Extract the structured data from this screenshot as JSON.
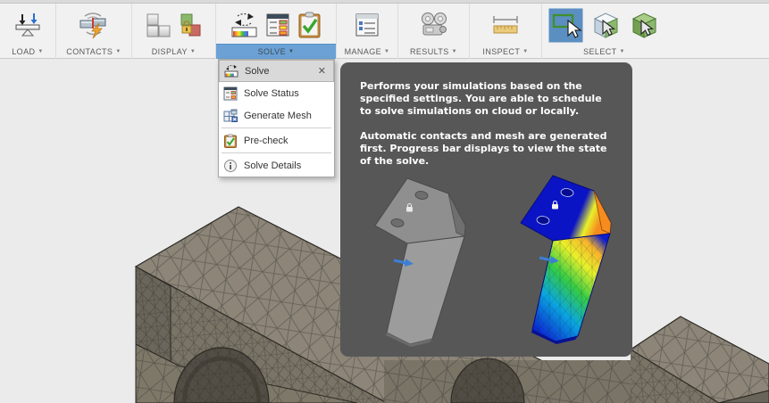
{
  "toolbar": {
    "caret": "▼",
    "groups": [
      {
        "label": "LOAD"
      },
      {
        "label": "CONTACTS"
      },
      {
        "label": "DISPLAY"
      },
      {
        "label": "SOLVE"
      },
      {
        "label": "MANAGE"
      },
      {
        "label": "RESULTS"
      },
      {
        "label": "INSPECT"
      },
      {
        "label": "SELECT"
      }
    ]
  },
  "menu": {
    "close_glyph": "✕",
    "items": [
      {
        "label": "Solve"
      },
      {
        "label": "Solve Status"
      },
      {
        "label": "Generate Mesh"
      },
      {
        "label": "Pre-check"
      },
      {
        "label": "Solve Details"
      }
    ]
  },
  "tooltip": {
    "paragraph1": "Performs your simulations based on the specified settings. You are able to schedule to solve simulations on cloud or locally.",
    "paragraph2": "Automatic contacts and mesh are generated first. Progress bar displays to view the state of the solve."
  },
  "colors": {
    "accent_blue": "#6ba1d5",
    "tooltip_bg": "#575757",
    "selection_bg": "#d9d9d9",
    "mesh_top_face": "#8c8578",
    "mesh_front_face": "#7a7467"
  }
}
